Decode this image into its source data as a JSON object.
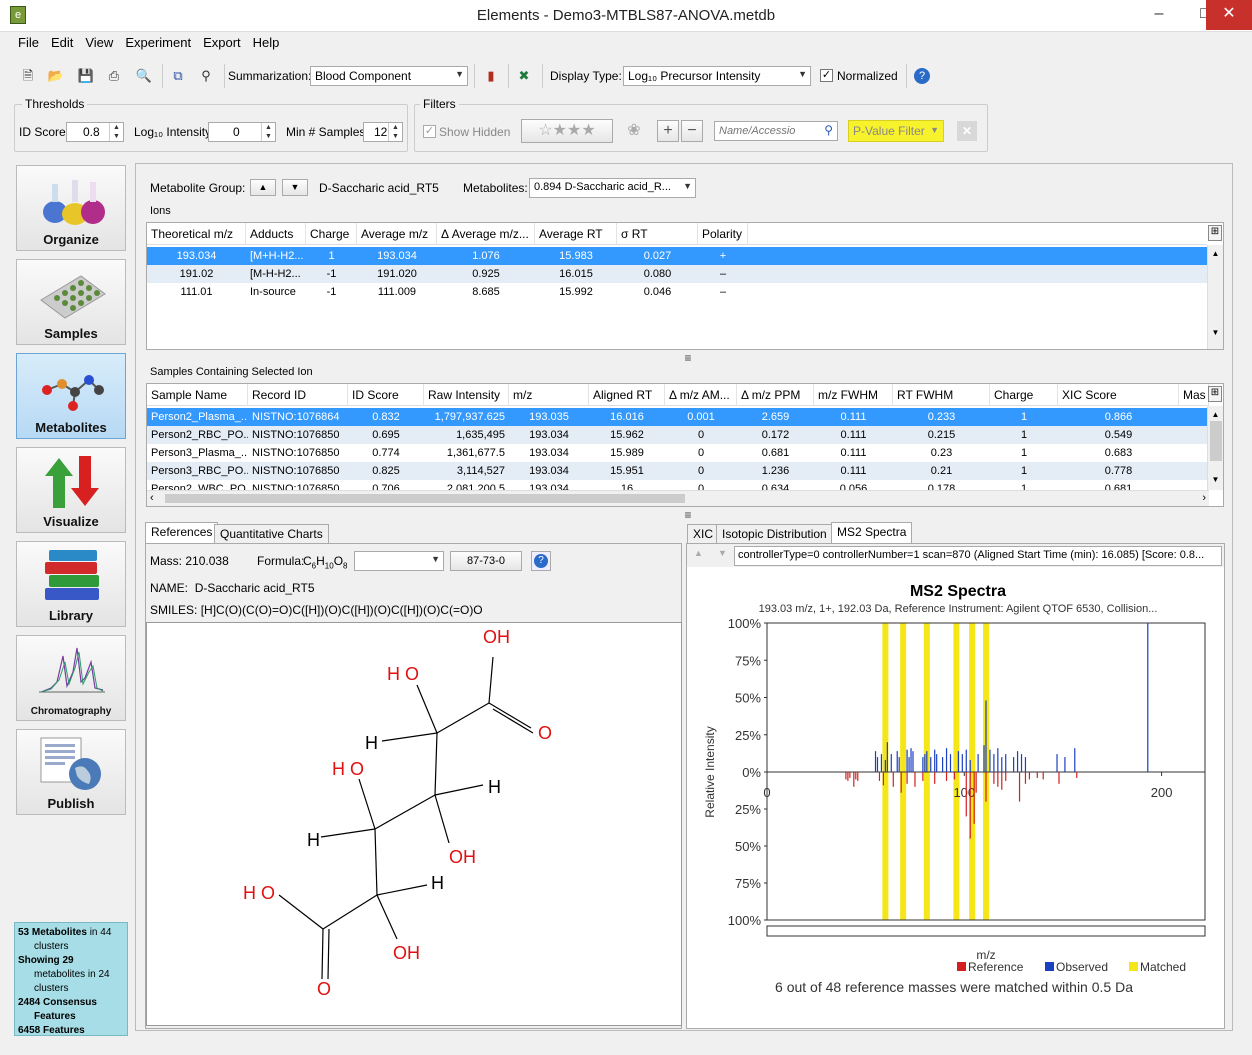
{
  "window": {
    "title": "Elements - Demo3-MTBLS87-ANOVA.metdb",
    "app_icon": "e"
  },
  "menu": [
    "File",
    "Edit",
    "View",
    "Experiment",
    "Export",
    "Help"
  ],
  "toolbar": {
    "summarization_label": "Summarization:",
    "summarization_value": "Blood Component",
    "display_type_label": "Display Type:",
    "display_type_value": "Log₁₀ Precursor Intensity",
    "normalized_label": "Normalized"
  },
  "thresholds": {
    "group_label": "Thresholds",
    "id_score_label": "ID Score",
    "id_score_value": "0.8",
    "log_intensity_label": "Log₁₀ Intensity",
    "log_intensity_value": "0",
    "min_samples_label": "Min # Samples",
    "min_samples_value": "12"
  },
  "filters": {
    "group_label": "Filters",
    "show_hidden_label": "Show Hidden",
    "name_placeholder": "Name/Accessio",
    "pvalue_label": "P-Value Filter"
  },
  "sidebar": [
    {
      "label": "Organize",
      "icon": "flasks-icon"
    },
    {
      "label": "Samples",
      "icon": "well-plate-icon"
    },
    {
      "label": "Metabolites",
      "icon": "molecule-icon"
    },
    {
      "label": "Visualize",
      "icon": "up-down-arrows-icon"
    },
    {
      "label": "Library",
      "icon": "books-icon"
    },
    {
      "label": "Chromatography",
      "icon": "chromatogram-icon"
    },
    {
      "label": "Publish",
      "icon": "globe-document-icon"
    }
  ],
  "stats": {
    "line1a": "53 Metabolites",
    "line1b": " in 44",
    "line2": "clusters",
    "line3": "Showing 29",
    "line4": "metabolites in 24",
    "line5": "clusters",
    "line6": "2484 Consensus",
    "line7": "Features",
    "line8": "6458 Features"
  },
  "metabolite_group": {
    "label": "Metabolite Group:",
    "value": "D-Saccharic acid_RT5",
    "metabolites_label": "Metabolites:",
    "metabolites_value": "0.894 D-Saccharic acid_R..."
  },
  "ions": {
    "title": "Ions",
    "headers": [
      "Theoretical m/z",
      "Adducts",
      "Charge",
      "Average m/z",
      "Δ Average m/z...",
      "Average RT",
      "σ RT",
      "Polarity"
    ],
    "rows": [
      [
        "193.034",
        "[M+H-H2...",
        "1",
        "193.034",
        "1.076",
        "15.983",
        "0.027",
        "+"
      ],
      [
        "191.02",
        "[M-H-H2...",
        "-1",
        "191.020",
        "0.925",
        "16.015",
        "0.080",
        "–"
      ],
      [
        "111.01",
        "In-source",
        "-1",
        "111.009",
        "8.685",
        "15.992",
        "0.046",
        "–"
      ]
    ]
  },
  "samples": {
    "title": "Samples Containing Selected Ion",
    "headers": [
      "Sample Name",
      "Record ID",
      "ID Score",
      "Raw Intensity",
      "m/z",
      "Aligned RT",
      "Δ m/z AM...",
      "Δ m/z PPM",
      "m/z FWHM",
      "RT FWHM",
      "Charge",
      "XIC Score",
      "Mas"
    ],
    "rows": [
      [
        "Person2_Plasma_...",
        "NISTNO:1076864",
        "0.832",
        "1,797,937.625",
        "193.035",
        "16.016",
        "0.001",
        "2.659",
        "0.111",
        "0.233",
        "1",
        "0.866"
      ],
      [
        "Person2_RBC_PO...",
        "NISTNO:1076850",
        "0.695",
        "1,635,495",
        "193.034",
        "15.962",
        "0",
        "0.172",
        "0.111",
        "0.215",
        "1",
        "0.549"
      ],
      [
        "Person3_Plasma_...",
        "NISTNO:1076850",
        "0.774",
        "1,361,677.5",
        "193.034",
        "15.989",
        "0",
        "0.681",
        "0.111",
        "0.23",
        "1",
        "0.683"
      ],
      [
        "Person3_RBC_PO...",
        "NISTNO:1076850",
        "0.825",
        "3,114,527",
        "193.034",
        "15.951",
        "0",
        "1.236",
        "0.111",
        "0.21",
        "1",
        "0.778"
      ],
      [
        "Person2_WBC_PO...",
        "NISTNO:1076850",
        "0.706",
        "2,081,200.5",
        "193.034",
        "16",
        "0",
        "0.634",
        "0.056",
        "0.178",
        "1",
        "0.681"
      ]
    ]
  },
  "references": {
    "tabs": [
      "References",
      "Quantitative Charts"
    ],
    "mass_label": "Mass:",
    "mass_value": "210.038",
    "formula_label": "Formula:",
    "formula": [
      "C",
      "6",
      "H",
      "10",
      "O",
      "8"
    ],
    "cas": "87-73-0",
    "name_label": "NAME:",
    "name_value": "D-Saccharic acid_RT5",
    "smiles_label": "SMILES:",
    "smiles_value": "[H]C(O)(C(O)=O)C([H])(O)C([H])(O)C([H])(O)C(=O)O"
  },
  "structure": {
    "atoms": [
      "OH",
      "H O",
      "O",
      "H",
      "H O",
      "H",
      "H",
      "OH",
      "H",
      "H O",
      "OH",
      "O"
    ]
  },
  "spectra": {
    "tabs": [
      "XIC",
      "Isotopic Distribution",
      "MS2 Spectra"
    ],
    "info": "controllerType=0 controllerNumber=1 scan=870 (Aligned Start Time (min): 16.085) [Score: 0.8...",
    "title": "MS2 Spectra",
    "subtitle": "193.03 m/z, 1+, 192.03 Da, Reference Instrument: Agilent QTOF 6530, Collision...",
    "ylabel": "Relative Intensity",
    "xlabel": "m/z",
    "y_ticks": [
      "100%",
      "75%",
      "50%",
      "25%",
      "0%",
      "25%",
      "50%",
      "75%",
      "100%"
    ],
    "x_ticks": [
      "0",
      "100",
      "200"
    ],
    "legend": [
      {
        "name": "Reference",
        "color": "#d21f1f"
      },
      {
        "name": "Observed",
        "color": "#1a3fc0"
      },
      {
        "name": "Matched",
        "color": "#f4e619"
      }
    ],
    "summary": "6 out of 48 reference masses were matched within 0.5 Da"
  },
  "chart_data": {
    "type": "bar",
    "title": "MS2 Spectra",
    "xlabel": "m/z",
    "ylabel": "Relative Intensity",
    "xlim": [
      0,
      222
    ],
    "ylim": [
      -100,
      100
    ],
    "series": [
      {
        "name": "Observed",
        "x": [
          55,
          56,
          58,
          60,
          61,
          63,
          66,
          67,
          71,
          72,
          73,
          74,
          79,
          80,
          81,
          83,
          85,
          86,
          89,
          91,
          93,
          97,
          99,
          101,
          103,
          107,
          110,
          111,
          113,
          115,
          117,
          119,
          121,
          125,
          127,
          129,
          131,
          147,
          151,
          156,
          193
        ],
        "y": [
          14,
          10,
          12,
          8,
          20,
          12,
          14,
          10,
          15,
          10,
          16,
          14,
          10,
          12,
          14,
          10,
          15,
          12,
          10,
          16,
          12,
          14,
          12,
          15,
          8,
          12,
          18,
          48,
          15,
          12,
          16,
          10,
          12,
          10,
          14,
          12,
          10,
          12,
          10,
          16,
          100
        ]
      },
      {
        "name": "Reference",
        "x": [
          40,
          41,
          42,
          44,
          45,
          46,
          57,
          59,
          64,
          68,
          71,
          75,
          79,
          85,
          91,
          95,
          101,
          103,
          105,
          106,
          111,
          115,
          117,
          119,
          121,
          128,
          131,
          133,
          137,
          140,
          148,
          157
        ],
        "y": [
          -5,
          -6,
          -4,
          -10,
          -5,
          -6,
          -6,
          -9,
          -10,
          -14,
          -8,
          -10,
          -6,
          -8,
          -6,
          -5,
          -30,
          -45,
          -35,
          -14,
          -20,
          -8,
          -10,
          -12,
          -6,
          -20,
          -8,
          -5,
          -4,
          -5,
          -8,
          -4
        ]
      },
      {
        "name": "Matched",
        "x": [
          60,
          69,
          81,
          96,
          104,
          111
        ]
      }
    ]
  }
}
